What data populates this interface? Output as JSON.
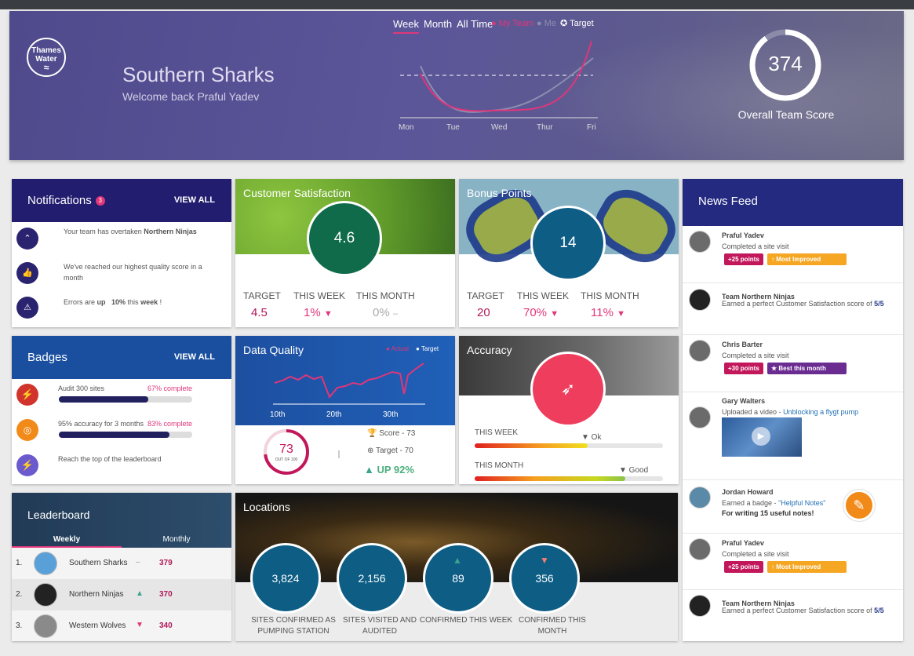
{
  "hero": {
    "logo": "Thames Water",
    "team_name": "Southern Sharks",
    "welcome": "Welcome back Praful Yadev",
    "tabs": [
      "Week",
      "Month",
      "All Time"
    ],
    "legend_my_team": "● My Team",
    "legend_me": "● Me",
    "legend_target": "✪ Target",
    "days": [
      "Mon",
      "Tue",
      "Wed",
      "Thur",
      "Fri"
    ],
    "score": "374",
    "score_label": "Overall Team Score",
    "score_fraction": 0.9
  },
  "notifications": {
    "title": "Notifications",
    "count": "3",
    "view_all": "VIEW ALL",
    "items": [
      {
        "icon": "chevron-up-icon",
        "text_a": "Your team has overtaken ",
        "bold": "Northern Ninjas"
      },
      {
        "icon": "thumbs-up-icon",
        "text": "We've reached our highest quality score in a month"
      },
      {
        "icon": "warning-icon",
        "text_a": "Errors are ",
        "bold_a": "up",
        "bold_b": "10%",
        "text_b": " this ",
        "bold_c": "week",
        "text_c": " !"
      }
    ]
  },
  "customer_satisfaction": {
    "title": "Customer Satisfaction",
    "value": "4.6",
    "target_label": "TARGET",
    "target": "4.5",
    "week_label": "THIS WEEK",
    "week": "1%",
    "month_label": "THIS MONTH",
    "month": "0%"
  },
  "bonus_points": {
    "title": "Bonus Points",
    "value": "14",
    "target_label": "TARGET",
    "target": "20",
    "week_label": "THIS WEEK",
    "week": "70%",
    "month_label": "THIS MONTH",
    "month": "11%"
  },
  "news": {
    "title": "News Feed",
    "items": [
      {
        "name": "Praful Yadev",
        "text": "Completed a site visit",
        "pill1": "+25 points",
        "pill2": "↑ Most Improved"
      },
      {
        "name": "Team Northern Ninjas",
        "text": "Earned a perfect Customer Satisfaction score of ",
        "score": "5/5"
      },
      {
        "name": "Chris Barter",
        "text": "Completed a site visit",
        "pill1": "+30 points",
        "pill2": "★ Best this month"
      },
      {
        "name": "Gary Walters",
        "text": "Uploaded a video - ",
        "link": "Unblocking a flygt pump"
      },
      {
        "name": "Jordan Howard",
        "text": "Earned a badge - ",
        "link": "\"Helpful Notes\"",
        "sub": "For writing 15 useful notes!"
      },
      {
        "name": "Praful Yadev",
        "text": "Completed a site visit",
        "pill1": "+25 points",
        "pill2": "↑ Most Improved"
      },
      {
        "name": "Team Northern Ninjas",
        "text": "Earned a perfect Customer Satisfaction score of ",
        "score": "5/5"
      }
    ]
  },
  "badges": {
    "title": "Badges",
    "view_all": "VIEW ALL",
    "items": [
      {
        "label": "Audit 300 sites",
        "pct": "67% complete",
        "fraction": 0.67
      },
      {
        "label": "95% accuracy for 3 months",
        "pct": "83% complete",
        "fraction": 0.83
      },
      {
        "label": "Reach the top of the leaderboard"
      }
    ]
  },
  "data_quality": {
    "title": "Data Quality",
    "legend_actual": "● Actual",
    "legend_target": "● Target",
    "x_ticks": [
      "10th",
      "20th",
      "30th"
    ],
    "gauge_value": "73",
    "gauge_sub": "OUT OF 100",
    "gauge_fraction": 0.73,
    "score": "Score - 73",
    "target": "Target - 70",
    "up": "UP 92%"
  },
  "accuracy": {
    "title": "Accuracy",
    "week_label": "THIS WEEK",
    "week_status": "▼ Ok",
    "week_fraction": 0.6,
    "month_label": "THIS MONTH",
    "month_status": "▼ Good",
    "month_fraction": 0.8
  },
  "leaderboard": {
    "title": "Leaderboard",
    "tabs": [
      "Weekly",
      "Monthly"
    ],
    "rows": [
      {
        "rank": "1.",
        "name": "Southern Sharks",
        "trend": "–",
        "points": "379"
      },
      {
        "rank": "2.",
        "name": "Northern Ninjas",
        "trend": "▲",
        "points": "370"
      },
      {
        "rank": "3.",
        "name": "Western Wolves",
        "trend": "▼",
        "points": "340"
      }
    ]
  },
  "locations": {
    "title": "Locations",
    "items": [
      {
        "value": "3,824",
        "label": "SITES CONFIRMED AS PUMPING STATION"
      },
      {
        "value": "2,156",
        "label": "SITES VISITED AND AUDITED"
      },
      {
        "value": "89",
        "label": "CONFIRMED THIS WEEK",
        "arrow": "▲"
      },
      {
        "value": "356",
        "label": "CONFIRMED THIS MONTH",
        "arrow": "▼"
      }
    ]
  }
}
